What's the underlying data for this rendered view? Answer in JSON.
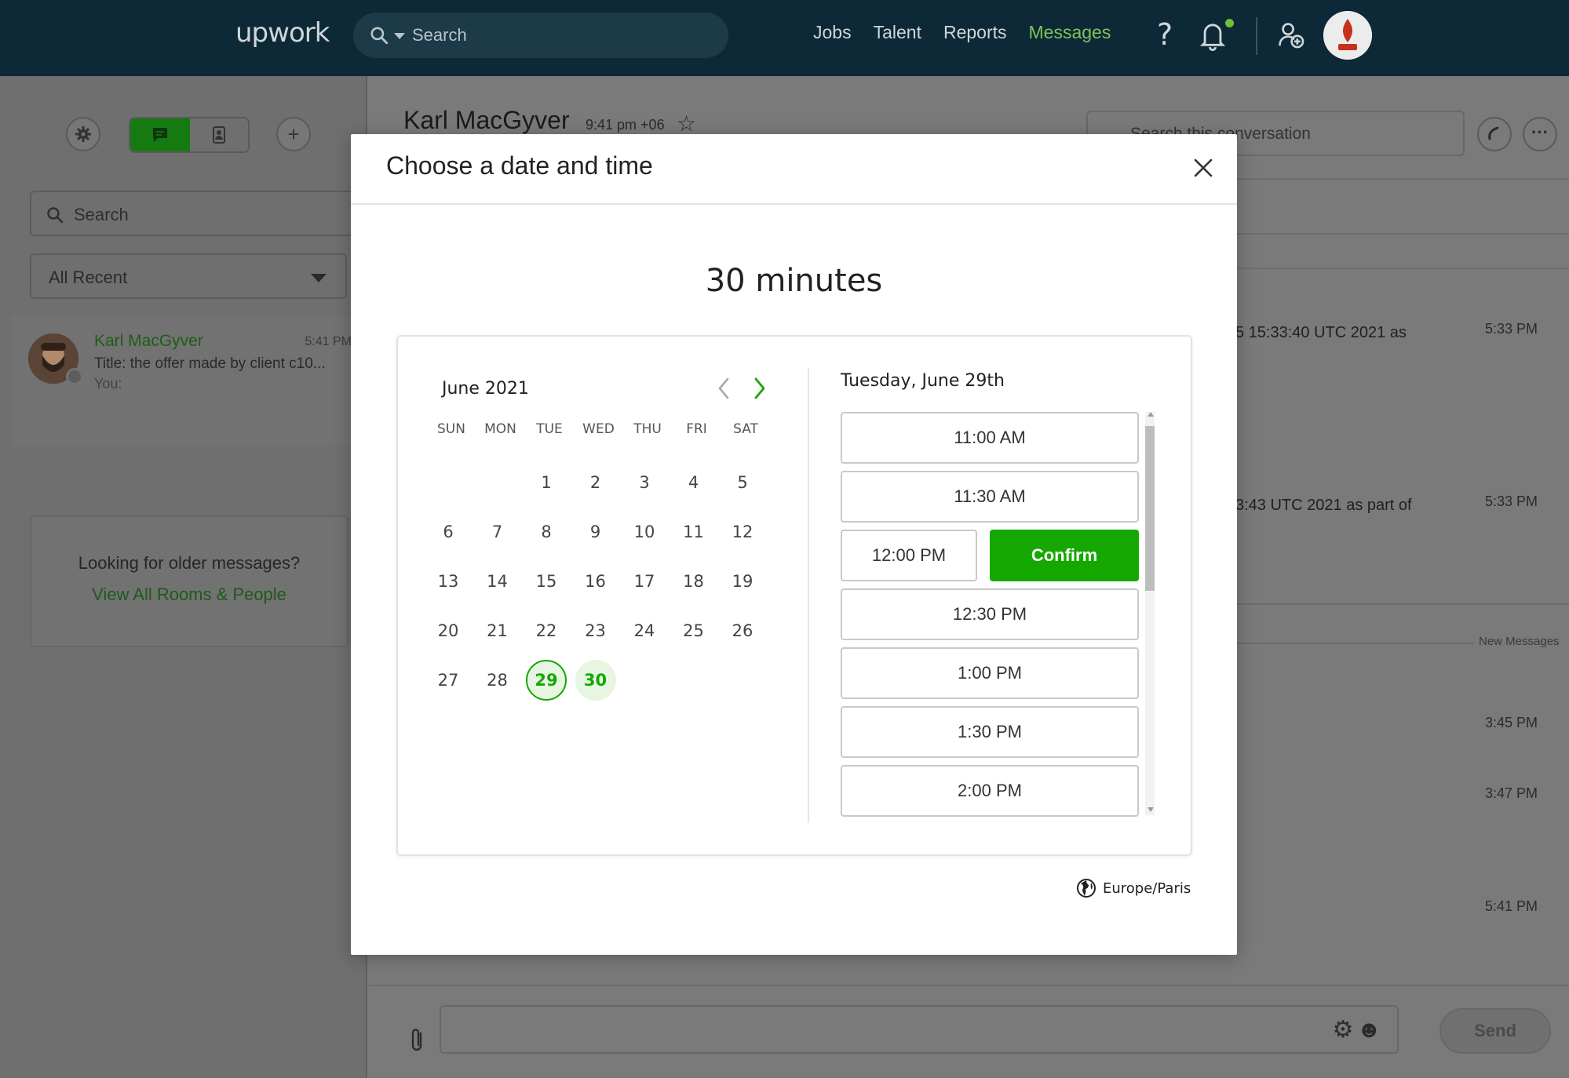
{
  "topnav": {
    "logo": "upwork",
    "search_placeholder": "Search",
    "links": [
      "Jobs",
      "Talent",
      "Reports",
      "Messages"
    ],
    "active_link": "Messages"
  },
  "sidebar": {
    "search_placeholder": "Search",
    "filter": "All Recent",
    "room": {
      "name": "Karl MacGyver",
      "time": "5:41 PM",
      "title": "Title: the offer made by client c10...",
      "you": "You:"
    },
    "older": {
      "question": "Looking for older messages?",
      "link": "View All Rooms & People"
    }
  },
  "chat": {
    "name": "Karl MacGyver",
    "local_time": "9:41 pm +06",
    "search_placeholder": "Search this conversation",
    "messages": [
      {
        "text": "5 15:33:40 UTC 2021 as",
        "time": "5:33 PM"
      },
      {
        "text": "3:43 UTC 2021 as part of",
        "time": "5:33 PM"
      },
      {
        "text": "",
        "time": "3:45 PM"
      },
      {
        "text": "",
        "time": "3:47 PM"
      },
      {
        "text": "",
        "time": "5:41 PM"
      }
    ],
    "new_messages": "New Messages",
    "send": "Send"
  },
  "modal": {
    "title": "Choose a date and time",
    "duration": "30 minutes",
    "calendar": {
      "month": "June 2021",
      "weekdays": [
        "SUN",
        "MON",
        "TUE",
        "WED",
        "THU",
        "FRI",
        "SAT"
      ],
      "first_weekday_index": 2,
      "days_in_month": 30,
      "available_days": [
        29,
        30
      ],
      "selected_day": 29
    },
    "selected_date": "Tuesday, June 29th",
    "slots": [
      "11:00 AM",
      "11:30 AM",
      "12:00 PM",
      "12:30 PM",
      "1:00 PM",
      "1:30 PM",
      "2:00 PM"
    ],
    "picked_slot": "12:00 PM",
    "confirm": "Confirm",
    "timezone": "Europe/Paris"
  },
  "colors": {
    "brand_green": "#14a800",
    "nav_bg": "#0d2836"
  }
}
